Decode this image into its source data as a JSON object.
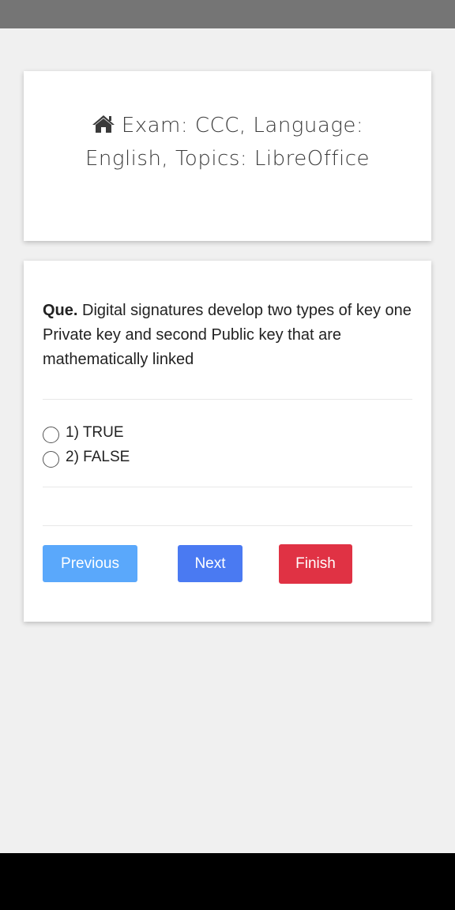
{
  "header": {
    "title": "Exam: CCC, Language: English, Topics: LibreOffice",
    "icon": "home-icon"
  },
  "question": {
    "prefix": "Que.",
    "text": "Digital signatures develop two types of key one Private key and second Public key that are mathematically linked"
  },
  "options": [
    {
      "label": "1) TRUE",
      "selected": false
    },
    {
      "label": "2) FALSE",
      "selected": false
    }
  ],
  "buttons": {
    "previous": "Previous",
    "next": "Next",
    "finish": "Finish"
  },
  "colors": {
    "previous": "#5aa8fb",
    "next": "#4a7af2",
    "finish": "#e03244",
    "background": "#f0f0f0"
  }
}
